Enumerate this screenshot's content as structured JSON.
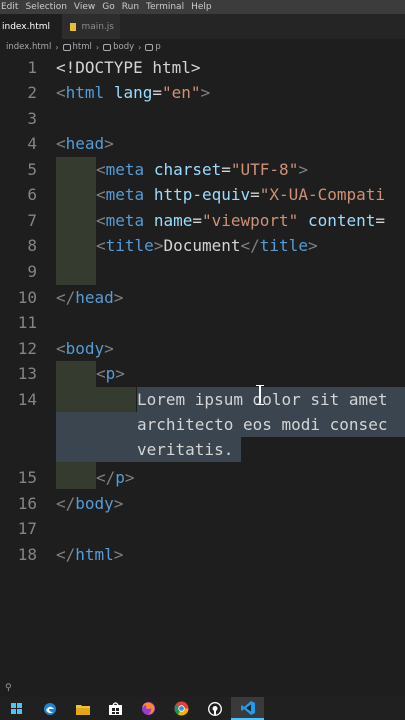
{
  "menubar": [
    "Edit",
    "Selection",
    "View",
    "Go",
    "Run",
    "Terminal",
    "Help"
  ],
  "tabs": [
    {
      "label": "index.html",
      "modified": true
    },
    {
      "label": "main.js",
      "modified": false
    }
  ],
  "breadcrumb": [
    "index.html",
    "html",
    "body",
    "p"
  ],
  "line_numbers": [
    "1",
    "2",
    "3",
    "4",
    "5",
    "6",
    "7",
    "8",
    "9",
    "10",
    "11",
    "12",
    "13",
    "14",
    "15",
    "16",
    "17",
    "18"
  ],
  "code": {
    "l1": "<!DOCTYPE html>",
    "l2": {
      "open": "<",
      "tag": "html",
      "attr": "lang",
      "eq": "=",
      "val": "\"en\"",
      "close": ">"
    },
    "l4": {
      "open": "<",
      "tag": "head",
      "close": ">"
    },
    "l5": {
      "open": "<",
      "tag": "meta",
      "attr": "charset",
      "eq": "=",
      "val": "\"UTF-8\"",
      "close": ">"
    },
    "l6": {
      "open": "<",
      "tag": "meta",
      "attr": "http-equiv",
      "eq": "=",
      "val": "\"X-UA-Compati"
    },
    "l7": {
      "open": "<",
      "tag": "meta",
      "attr": "name",
      "eq": "=",
      "val": "\"viewport\"",
      "attr2": "content",
      "eq2": "="
    },
    "l8": {
      "open": "<",
      "tag": "title",
      "close": ">",
      "text": "Document",
      "open2": "</",
      "tag2": "title",
      "close2": ">"
    },
    "l10": {
      "open": "</",
      "tag": "head",
      "close": ">"
    },
    "l12": {
      "open": "<",
      "tag": "body",
      "close": ">"
    },
    "l13": {
      "open": "<",
      "tag": "p",
      "close": ">"
    },
    "l14a": "Lorem ipsum dolor sit amet",
    "l14b": "architecto eos modi consec",
    "l14c": "veritatis.",
    "l15": {
      "open": "</",
      "tag": "p",
      "close": ">"
    },
    "l16": {
      "open": "</",
      "tag": "body",
      "close": ">"
    },
    "l18": {
      "open": "</",
      "tag": "html",
      "close": ">"
    }
  },
  "statusbar": {
    "branch_icon": "⚲"
  },
  "taskbar": [
    {
      "icon": "windows-start-icon",
      "active": false
    },
    {
      "icon": "edge-icon",
      "active": false
    },
    {
      "icon": "file-explorer-icon",
      "active": false
    },
    {
      "icon": "store-icon",
      "active": false
    },
    {
      "icon": "firefox-icon",
      "active": false
    },
    {
      "icon": "chrome-icon",
      "active": false
    },
    {
      "icon": "github-icon",
      "active": false
    },
    {
      "icon": "vscode-icon",
      "active": true
    }
  ],
  "colors": {
    "tag": "#569cd6",
    "attr": "#9cdcfe",
    "string": "#ce9178",
    "bracket": "#808080",
    "selection": "#3a4550"
  }
}
